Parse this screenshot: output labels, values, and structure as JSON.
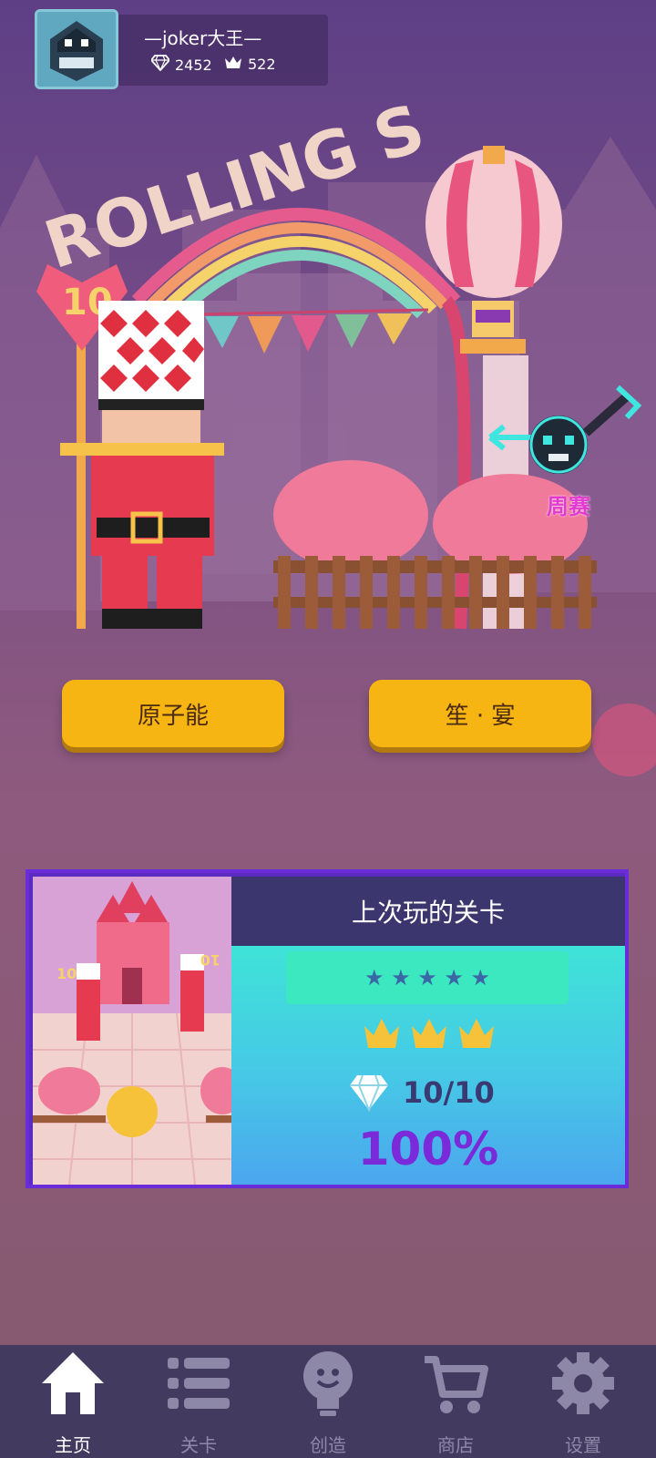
{
  "profile": {
    "name": "—joker大王—",
    "gems": "2452",
    "crowns": "522"
  },
  "scene": {
    "logo_text": "ROLLING S",
    "heart_badge": "10",
    "weekly_label": "周赛"
  },
  "modes": {
    "left_label": "原子能",
    "right_label": "笙 · 宴"
  },
  "last_played": {
    "title": "上次玩的关卡",
    "stars": "★ ★ ★ ★ ★",
    "crowns_earned": 3,
    "gems": "10/10",
    "percent": "100%",
    "thumb_badge_left": "10",
    "thumb_badge_right": "10"
  },
  "nav": {
    "items": [
      {
        "label": "主页",
        "icon": "home-icon",
        "active": true
      },
      {
        "label": "关卡",
        "icon": "list-icon",
        "active": false
      },
      {
        "label": "创造",
        "icon": "lightbulb-icon",
        "active": false
      },
      {
        "label": "商店",
        "icon": "cart-icon",
        "active": false
      },
      {
        "label": "设置",
        "icon": "gear-icon",
        "active": false
      }
    ]
  },
  "colors": {
    "button": "#f6b512",
    "card_border": "#6a2bd8",
    "percent": "#7a2ad8",
    "nav_bg": "#433b5f"
  }
}
